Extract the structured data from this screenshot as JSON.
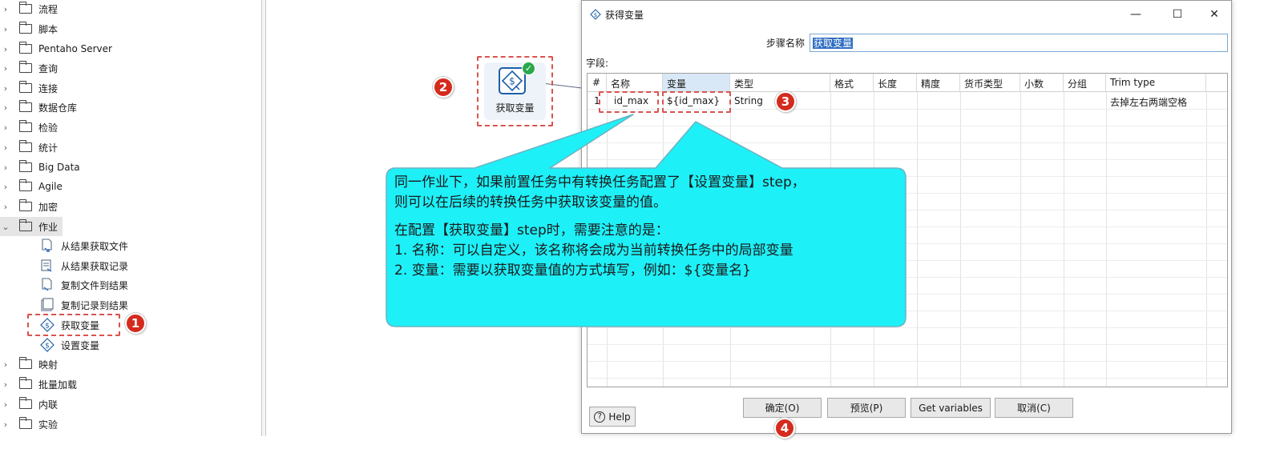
{
  "tree": {
    "folders": [
      {
        "label": "流程",
        "expanded": false
      },
      {
        "label": "脚本",
        "expanded": false
      },
      {
        "label": "Pentaho Server",
        "expanded": false
      },
      {
        "label": "查询",
        "expanded": false
      },
      {
        "label": "连接",
        "expanded": false
      },
      {
        "label": "数据仓库",
        "expanded": false
      },
      {
        "label": "检验",
        "expanded": false
      },
      {
        "label": "统计",
        "expanded": false
      },
      {
        "label": "Big Data",
        "expanded": false
      },
      {
        "label": "Agile",
        "expanded": false
      },
      {
        "label": "加密",
        "expanded": false
      },
      {
        "label": "作业",
        "expanded": true
      }
    ],
    "job_items": [
      {
        "label": "从结果获取文件",
        "icon": "file-result-icon"
      },
      {
        "label": "从结果获取记录",
        "icon": "record-result-icon"
      },
      {
        "label": "复制文件到结果",
        "icon": "copy-file-icon"
      },
      {
        "label": "复制记录到结果",
        "icon": "copy-record-icon"
      },
      {
        "label": "获取变量",
        "icon": "get-variable-icon"
      },
      {
        "label": "设置变量",
        "icon": "set-variable-icon"
      }
    ],
    "folders_after": [
      {
        "label": "映射",
        "expanded": false
      },
      {
        "label": "批量加载",
        "expanded": false
      },
      {
        "label": "内联",
        "expanded": false
      },
      {
        "label": "实验",
        "expanded": false
      }
    ]
  },
  "canvas": {
    "step_label": "获取变量"
  },
  "badges": [
    "1",
    "2",
    "3",
    "4"
  ],
  "dialog": {
    "title": "获得变量",
    "minimize_icon": "minimize-icon",
    "maximize_icon": "maximize-icon",
    "close_icon": "close-icon",
    "step_name_label": "步骤名称",
    "step_name_value": "获取变量",
    "fields_label": "字段:",
    "columns": [
      "#",
      "名称",
      "变量",
      "类型",
      "格式",
      "长度",
      "精度",
      "货币类型",
      "小数",
      "分组",
      "Trim type"
    ],
    "rows": [
      [
        "1",
        "id_max",
        "${id_max}",
        "String",
        "",
        "",
        "",
        "",
        "",
        "",
        "去掉左右两端空格"
      ]
    ],
    "buttons": {
      "help": "Help",
      "ok": "确定(O)",
      "preview": "预览(P)",
      "get_variables": "Get variables",
      "cancel": "取消(C)"
    }
  },
  "callout": {
    "line1": "同一作业下，如果前置任务中有转换任务配置了【设置变量】step，",
    "line2": "则可以在后续的转换任务中获取该变量的值。",
    "line3": "在配置【获取变量】step时，需要注意的是：",
    "line4": "1. 名称：可以自定义，该名称将会成为当前转换任务中的局部变量",
    "line5": "2. 变量：需要以获取变量值的方式填写，例如：${变量名}",
    "fill_color": "#1ef0f8",
    "border_color": "#6ab3c0"
  },
  "colors": {
    "badge": "#d42b1e",
    "dashed_highlight": "#d9534f",
    "selection": "#2f6ec2"
  }
}
